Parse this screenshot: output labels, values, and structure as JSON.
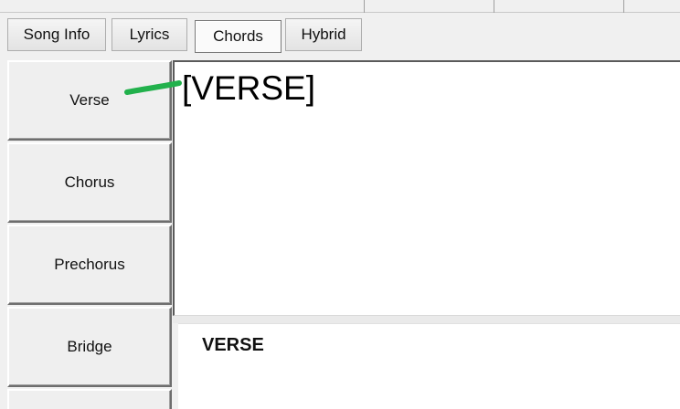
{
  "tabs": [
    {
      "label": "Song Info",
      "active": false
    },
    {
      "label": "Lyrics",
      "active": false
    },
    {
      "label": "Chords",
      "active": true
    },
    {
      "label": "Hybrid",
      "active": false
    }
  ],
  "sections": [
    {
      "label": "Verse"
    },
    {
      "label": "Chorus"
    },
    {
      "label": "Prechorus"
    },
    {
      "label": "Bridge"
    }
  ],
  "editor": {
    "text": "[VERSE]"
  },
  "preview": {
    "heading": "VERSE"
  },
  "colors": {
    "annotation": "#22b14c",
    "background": "#f0f0f0"
  }
}
